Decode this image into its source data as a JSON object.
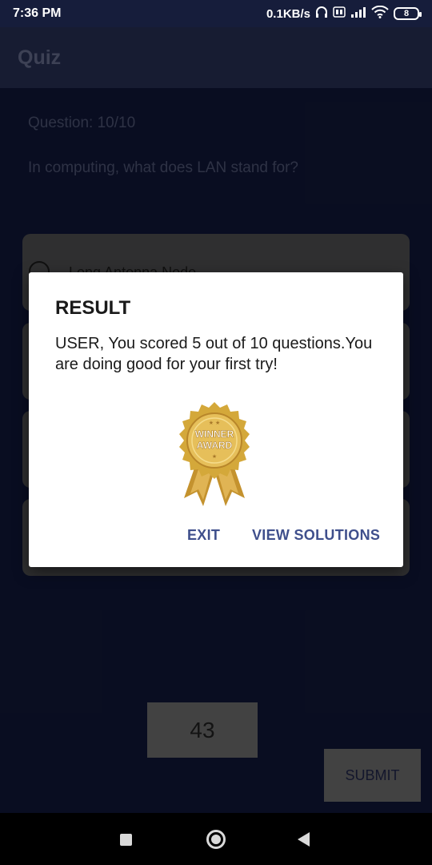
{
  "status_bar": {
    "time": "7:36 PM",
    "network_speed": "0.1KB/s",
    "battery_level": "8",
    "icons": [
      "headset-icon",
      "volte-icon",
      "signal-icon",
      "wifi-icon",
      "battery-icon"
    ]
  },
  "app_bar": {
    "title": "Quiz"
  },
  "question": {
    "counter": "Question: 10/10",
    "text": "In computing, what does LAN stand for?"
  },
  "options": [
    "Long Antenna Node",
    "",
    "",
    ""
  ],
  "timer": {
    "value": "43"
  },
  "submit_label": "SUBMIT",
  "dialog": {
    "title": "RESULT",
    "message": "USER, You scored 5 out of 10 questions.You are doing good for your first try!",
    "award_text": [
      "WINNER",
      "AWARD"
    ],
    "exit_label": "EXIT",
    "view_solutions_label": "VIEW SOLUTIONS"
  },
  "colors": {
    "background": "#101636",
    "app_bar": "#262e52",
    "dialog_button": "#3f4f8c",
    "option_card": "#4c4c4e",
    "award_gold": "#d4a83a"
  }
}
